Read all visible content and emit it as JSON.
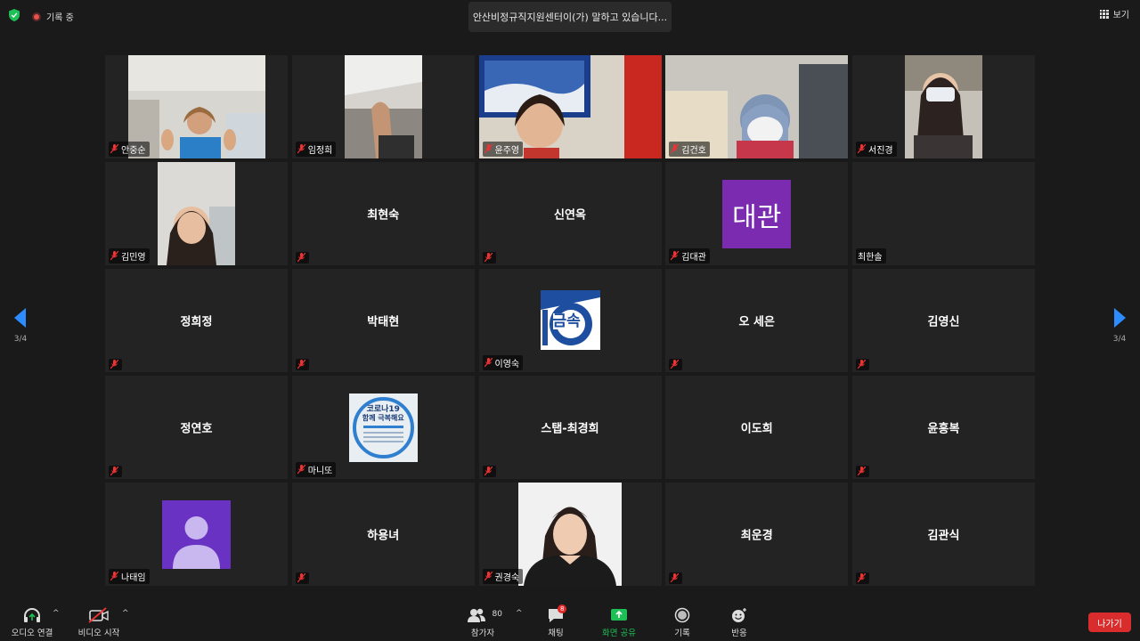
{
  "topbar": {
    "recording_label": "기록 중",
    "speaking_label": "안산비정규직지원센터이(가) 말하고 있습니다...",
    "view_label": "보기"
  },
  "pagination": {
    "left": "3/4",
    "right": "3/4"
  },
  "participants": [
    {
      "name": "안중순",
      "mode": "video"
    },
    {
      "name": "임정희",
      "mode": "video"
    },
    {
      "name": "윤주영",
      "mode": "video"
    },
    {
      "name": "김건호",
      "mode": "video"
    },
    {
      "name": "서진경",
      "mode": "video"
    },
    {
      "name": "김민영",
      "mode": "video"
    },
    {
      "name": "최현숙",
      "mode": "name"
    },
    {
      "name": "신연옥",
      "mode": "name"
    },
    {
      "name": "김대관",
      "mode": "avatar",
      "avatar_text": "대관",
      "avatar_color": "#7b2bb0"
    },
    {
      "name": "최한솔",
      "mode": "label-only"
    },
    {
      "name": "정희정",
      "mode": "name"
    },
    {
      "name": "박태현",
      "mode": "name"
    },
    {
      "name": "이영숙",
      "mode": "logo",
      "logo_text": "금속"
    },
    {
      "name": "오 세은",
      "mode": "name"
    },
    {
      "name": "김영신",
      "mode": "name"
    },
    {
      "name": "정연호",
      "mode": "name"
    },
    {
      "name": "마니또",
      "mode": "poster",
      "poster_title": "코로나19",
      "poster_subtitle": "함께 극복해요"
    },
    {
      "name": "스탭-최경희",
      "mode": "name"
    },
    {
      "name": "이도희",
      "mode": "name"
    },
    {
      "name": "윤흥복",
      "mode": "name"
    },
    {
      "name": "나태임",
      "mode": "default-avatar"
    },
    {
      "name": "하용녀",
      "mode": "name"
    },
    {
      "name": "권경숙",
      "mode": "video"
    },
    {
      "name": "최운경",
      "mode": "name"
    },
    {
      "name": "김관식",
      "mode": "name"
    }
  ],
  "toolbar": {
    "audio_label": "오디오 연결",
    "video_label": "비디오 시작",
    "participants_label": "참가자",
    "participants_count": "80",
    "chat_label": "채팅",
    "chat_badge": "8",
    "share_label": "화면 공유",
    "record_label": "기록",
    "reactions_label": "반응",
    "leave_label": "나가기"
  },
  "colors": {
    "background": "#1a1a1a",
    "tile": "#232323",
    "accent_blue": "#2d8cff",
    "share_green": "#1fbf57",
    "leave_red": "#d92d2d"
  }
}
